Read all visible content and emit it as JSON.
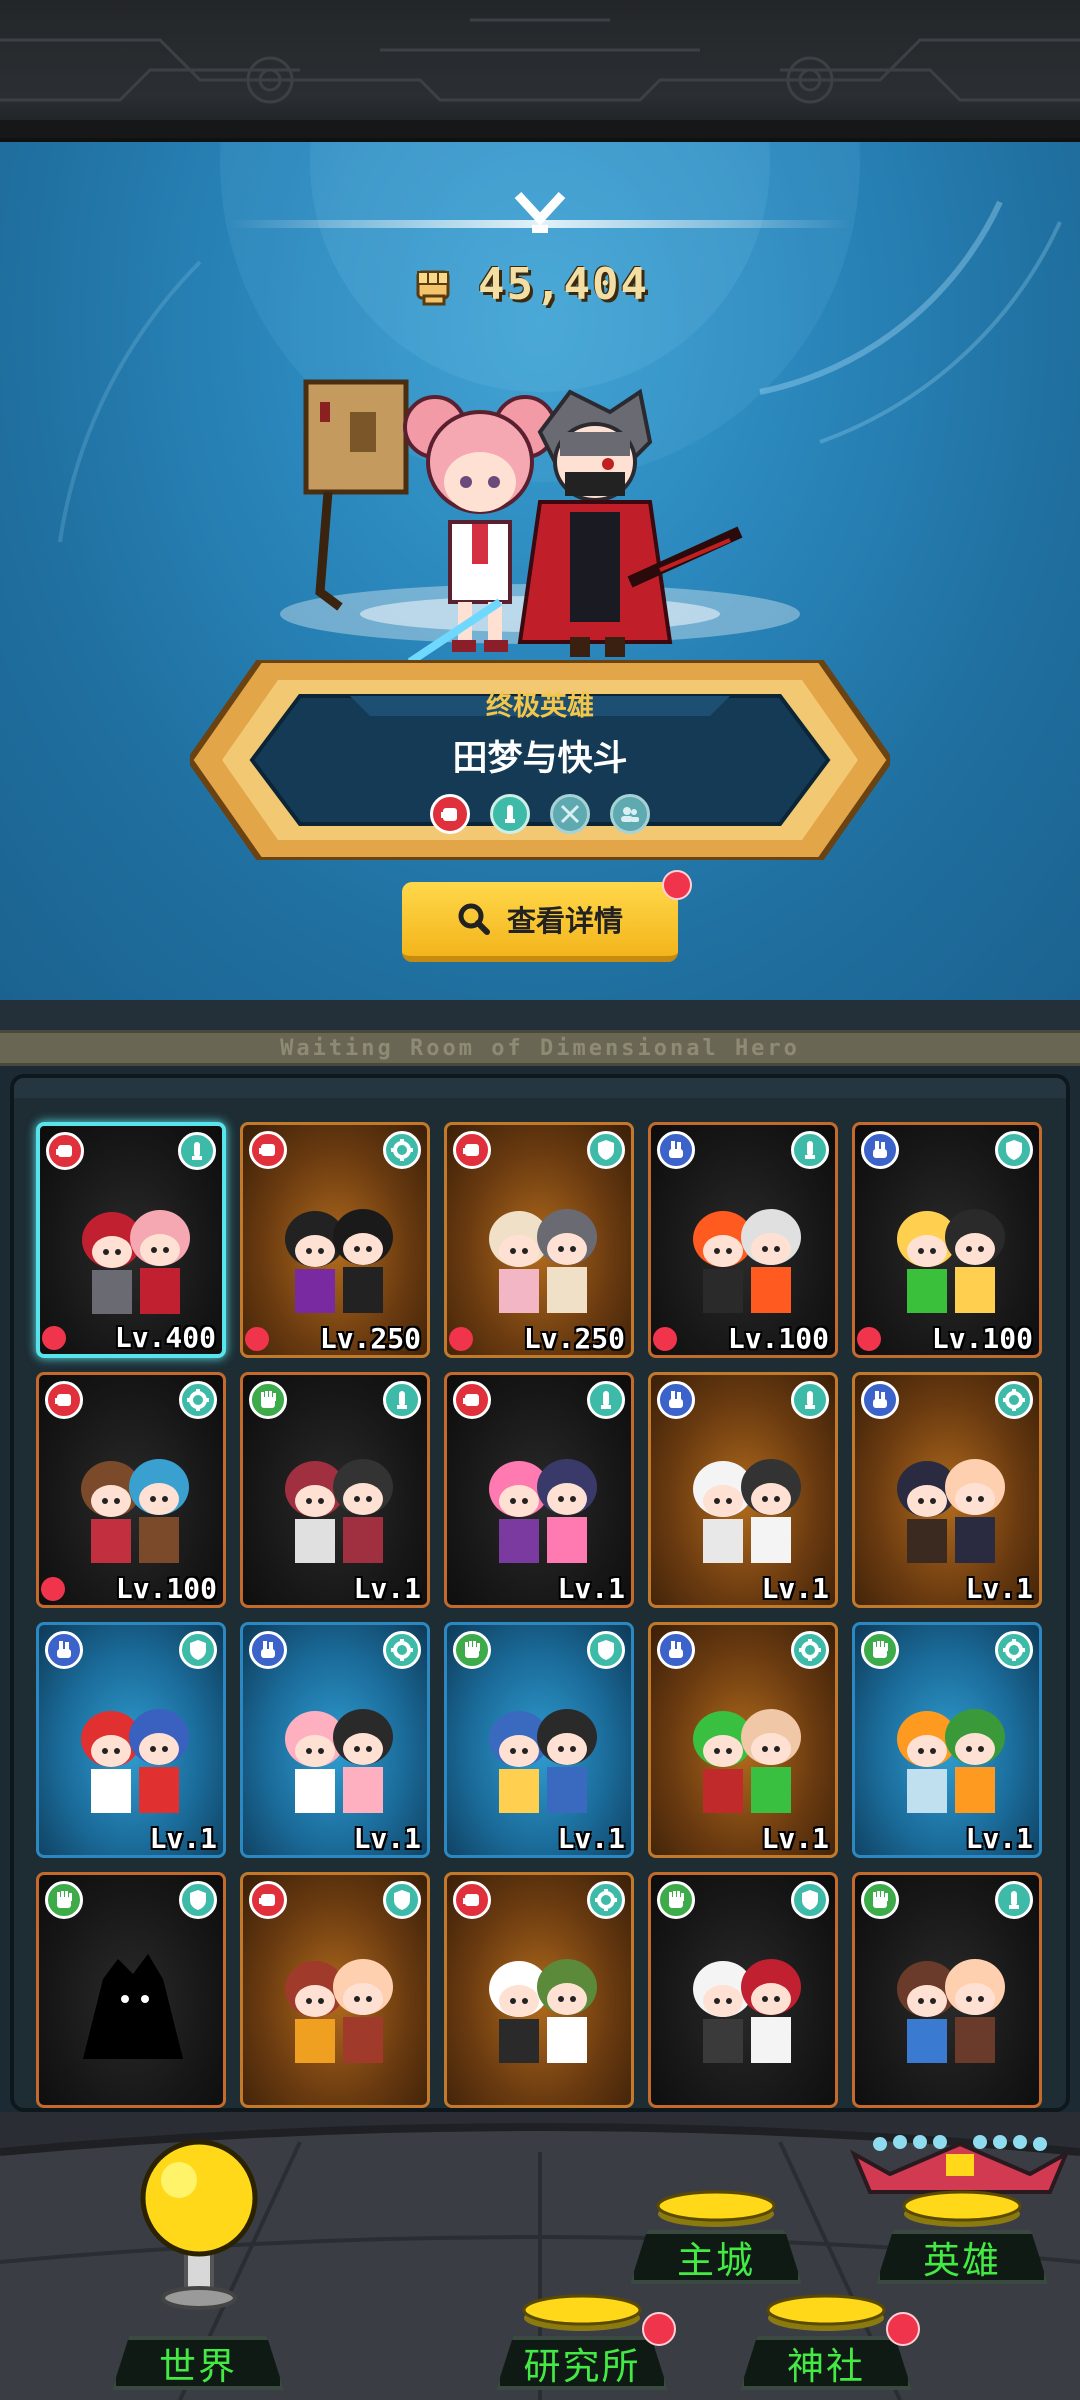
{
  "header": {
    "combat_power": "45,404"
  },
  "featured_hero": {
    "rank": "终极英雄",
    "name": "田梦与快斗",
    "attributes": [
      {
        "icon": "rock-fist-icon",
        "color": "#e0303c"
      },
      {
        "icon": "pillar-icon",
        "color": "#3dbba8"
      },
      {
        "icon": "crossed-swords-icon",
        "color": "#5fa9b0"
      },
      {
        "icon": "team-icon",
        "color": "#5fa9b0"
      }
    ]
  },
  "details_button": {
    "label": "查看详情"
  },
  "room": {
    "title": "Waiting Room of Dimensional Hero"
  },
  "heroes": [
    {
      "level": "Lv.400",
      "theme": "dark",
      "left_icon": "rock-fist-icon",
      "left_color": "red",
      "right_icon": "pillar-icon",
      "right_color": "teal",
      "dot": true,
      "selected": true
    },
    {
      "level": "Lv.250",
      "theme": "orange",
      "left_icon": "rock-fist-icon",
      "left_color": "red",
      "right_icon": "gear-icon",
      "right_color": "teal",
      "dot": true
    },
    {
      "level": "Lv.250",
      "theme": "orange",
      "left_icon": "rock-fist-icon",
      "left_color": "red",
      "right_icon": "shield-icon",
      "right_color": "teal",
      "dot": true
    },
    {
      "level": "Lv.100",
      "theme": "dark",
      "left_icon": "scissors-hand-icon",
      "left_color": "blue",
      "right_icon": "pillar-icon",
      "right_color": "teal",
      "dot": true
    },
    {
      "level": "Lv.100",
      "theme": "dark",
      "left_icon": "scissors-hand-icon",
      "left_color": "blue",
      "right_icon": "shield-icon",
      "right_color": "teal",
      "dot": true
    },
    {
      "level": "Lv.100",
      "theme": "dark",
      "left_icon": "rock-fist-icon",
      "left_color": "red",
      "right_icon": "gear-icon",
      "right_color": "teal",
      "dot": true
    },
    {
      "level": "Lv.1",
      "theme": "dark",
      "left_icon": "paper-hand-icon",
      "left_color": "green",
      "right_icon": "pillar-icon",
      "right_color": "teal",
      "dot": false
    },
    {
      "level": "Lv.1",
      "theme": "dark",
      "left_icon": "rock-fist-icon",
      "left_color": "red",
      "right_icon": "pillar-icon",
      "right_color": "teal",
      "dot": false
    },
    {
      "level": "Lv.1",
      "theme": "orange",
      "left_icon": "scissors-hand-icon",
      "left_color": "blue",
      "right_icon": "pillar-icon",
      "right_color": "teal",
      "dot": false
    },
    {
      "level": "Lv.1",
      "theme": "orange",
      "left_icon": "scissors-hand-icon",
      "left_color": "blue",
      "right_icon": "gear-icon",
      "right_color": "teal",
      "dot": false
    },
    {
      "level": "Lv.1",
      "theme": "blue",
      "left_icon": "scissors-hand-icon",
      "left_color": "blue",
      "right_icon": "shield-icon",
      "right_color": "teal",
      "dot": false
    },
    {
      "level": "Lv.1",
      "theme": "blue",
      "left_icon": "scissors-hand-icon",
      "left_color": "blue",
      "right_icon": "gear-icon",
      "right_color": "teal",
      "dot": false
    },
    {
      "level": "Lv.1",
      "theme": "blue",
      "left_icon": "paper-hand-icon",
      "left_color": "green",
      "right_icon": "shield-icon",
      "right_color": "teal",
      "dot": false
    },
    {
      "level": "Lv.1",
      "theme": "orange",
      "left_icon": "scissors-hand-icon",
      "left_color": "blue",
      "right_icon": "gear-icon",
      "right_color": "teal",
      "dot": false
    },
    {
      "level": "Lv.1",
      "theme": "blue",
      "left_icon": "paper-hand-icon",
      "left_color": "green",
      "right_icon": "gear-icon",
      "right_color": "teal",
      "dot": false
    },
    {
      "level": "",
      "theme": "dark",
      "left_icon": "paper-hand-icon",
      "left_color": "green",
      "right_icon": "shield-icon",
      "right_color": "teal",
      "dot": false
    },
    {
      "level": "",
      "theme": "orange",
      "left_icon": "rock-fist-icon",
      "left_color": "red",
      "right_icon": "shield-icon",
      "right_color": "teal",
      "dot": false
    },
    {
      "level": "",
      "theme": "orange",
      "left_icon": "rock-fist-icon",
      "left_color": "red",
      "right_icon": "gear-icon",
      "right_color": "teal",
      "dot": false
    },
    {
      "level": "",
      "theme": "dark",
      "left_icon": "paper-hand-icon",
      "left_color": "green",
      "right_icon": "shield-icon",
      "right_color": "teal",
      "dot": false
    },
    {
      "level": "",
      "theme": "dark",
      "left_icon": "paper-hand-icon",
      "left_color": "green",
      "right_icon": "pillar-icon",
      "right_color": "teal",
      "dot": false
    }
  ],
  "nav": {
    "world": "世界",
    "main_city": "主城",
    "heroes": "英雄",
    "research": "研究所",
    "shrine": "神社"
  },
  "colors": {
    "accent_gold": "#f3c64a",
    "button_yellow": "#ffd84a",
    "notify_red": "#f0344c",
    "nav_green": "#44ea44",
    "selected_cyan": "#57e4ea"
  }
}
